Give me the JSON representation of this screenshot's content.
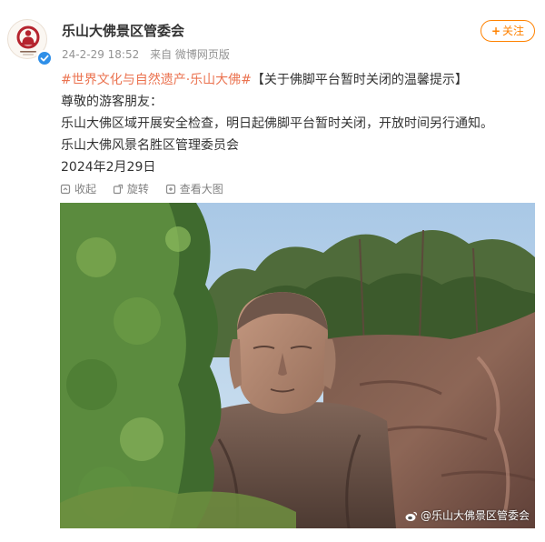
{
  "header": {
    "account_name": "乐山大佛景区管委会",
    "timestamp": "24-2-29 18:52",
    "source": "来自 微博网页版",
    "follow_label": "关注",
    "follow_prefix": "+"
  },
  "post": {
    "hashtags": "#世界文化与自然遗产·乐山大佛#",
    "headline": "【关于佛脚平台暂时关闭的温馨提示】",
    "greeting": "尊敬的游客朋友：",
    "body": "乐山大佛区域开展安全检查，明日起佛脚平台暂时关闭，开放时间另行通知。",
    "signature": "乐山大佛风景名胜区管理委员会",
    "date": "2024年2月29日"
  },
  "image_tools": {
    "collapse": "收起",
    "rotate": "旋转",
    "view_large": "查看大图"
  },
  "photo": {
    "watermark": "@乐山大佛景区管委会"
  },
  "colors": {
    "accent_orange": "#ff8200",
    "hashtag": "#eb7350",
    "verified_blue": "#2f8fe8",
    "logo_red": "#b5242e"
  }
}
